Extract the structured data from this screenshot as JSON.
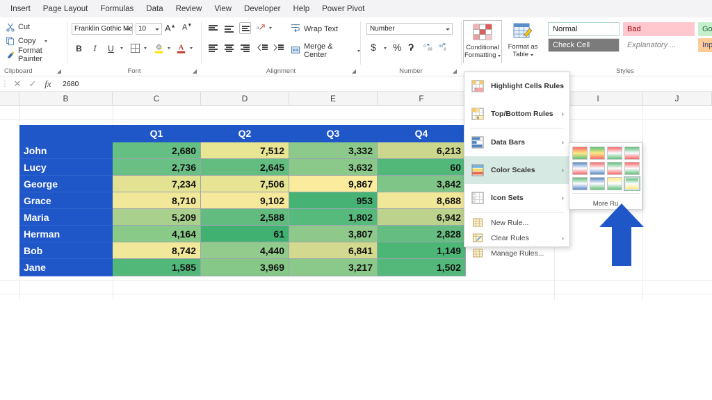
{
  "menubar": {
    "items": [
      {
        "label": "Insert"
      },
      {
        "label": "Page Layout"
      },
      {
        "label": "Formulas"
      },
      {
        "label": "Data"
      },
      {
        "label": "Review"
      },
      {
        "label": "View"
      },
      {
        "label": "Developer"
      },
      {
        "label": "Help"
      },
      {
        "label": "Power Pivot"
      }
    ]
  },
  "ribbon": {
    "clipboard": {
      "label": "Clipboard",
      "cut": "Cut",
      "copy": "Copy",
      "format_painter": "Format Painter"
    },
    "font": {
      "label": "Font",
      "font_name": "Franklin Gothic Me",
      "font_size": "10",
      "grow_font": "A",
      "shrink_font": "A",
      "bold": "B",
      "italic": "I",
      "underline": "U"
    },
    "alignment": {
      "label": "Alignment",
      "wrap_text": "Wrap Text",
      "merge_center": "Merge & Center"
    },
    "number": {
      "label": "Number",
      "format": "Number",
      "currency": "$",
      "percent": "%",
      "comma": "ʔ"
    },
    "styles": {
      "label": "Styles",
      "conditional_formatting": "Conditional\nFormatting",
      "conditional_formatting_l1": "Conditional",
      "conditional_formatting_l2": "Formatting",
      "format_as_table_l1": "Format as",
      "format_as_table_l2": "Table",
      "cells": [
        {
          "label": "Normal",
          "bg": "#ffffff",
          "fg": "#222222",
          "border": "#a9d5c3",
          "italic": false
        },
        {
          "label": "Bad",
          "bg": "#ffc7ce",
          "fg": "#9c0006",
          "border": "#ffc7ce",
          "italic": false
        },
        {
          "label": "Good",
          "bg": "#c6efce",
          "fg": "#1f6b38",
          "border": "#c6efce",
          "italic": false
        },
        {
          "label": "Check Cell",
          "bg": "#7b7b7b",
          "fg": "#ffffff",
          "border": "#7b7b7b",
          "italic": false
        },
        {
          "label": "Explanatory ...",
          "bg": "#ffffff",
          "fg": "#7f7f7f",
          "border": "#ffffff",
          "italic": true
        },
        {
          "label": "Input",
          "bg": "#ffcc99",
          "fg": "#3f3f76",
          "border": "#ffcc99",
          "italic": false
        }
      ]
    }
  },
  "formula_bar": {
    "cancel": "✕",
    "confirm": "✓",
    "fx": "fx",
    "value": "2680"
  },
  "grid": {
    "column_headers": [
      "B",
      "C",
      "D",
      "E",
      "F",
      "I",
      "J"
    ],
    "table_header": [
      "",
      "Q1",
      "Q2",
      "Q3",
      "Q4"
    ],
    "rows": [
      {
        "name": "John",
        "values": [
          "2,680",
          "7,512",
          "3,332",
          "6,213"
        ],
        "colors": [
          "#66bf82",
          "#e8e593",
          "#8cc98a",
          "#cbd78d"
        ]
      },
      {
        "name": "Lucy",
        "values": [
          "2,736",
          "2,645",
          "3,632",
          "60"
        ],
        "colors": [
          "#6abf84",
          "#63bd80",
          "#8ac98a",
          "#51b879"
        ]
      },
      {
        "name": "George",
        "values": [
          "7,234",
          "7,506",
          "9,867",
          "3,842"
        ],
        "colors": [
          "#e2e292",
          "#e7e493",
          "#fbeb9d",
          "#7fc587"
        ]
      },
      {
        "name": "Grace",
        "values": [
          "8,710",
          "9,102",
          "953",
          "8,688"
        ],
        "colors": [
          "#f2e89a",
          "#f6e99b",
          "#46b374",
          "#f1e799"
        ]
      },
      {
        "name": "Maria",
        "values": [
          "5,209",
          "2,588",
          "1,802",
          "6,942"
        ],
        "colors": [
          "#a9d08c",
          "#62bc7f",
          "#55ba7b",
          "#bdd38d"
        ]
      },
      {
        "name": "Herman",
        "values": [
          "4,164",
          "61",
          "3,807",
          "2,828"
        ],
        "colors": [
          "#8aca89",
          "#41b171",
          "#8ec98b",
          "#65bd81"
        ]
      },
      {
        "name": "Bob",
        "values": [
          "8,742",
          "4,440",
          "6,841",
          "1,149"
        ],
        "colors": [
          "#f2e89a",
          "#92cb8c",
          "#d3da8f",
          "#4cb677"
        ]
      },
      {
        "name": "Jane",
        "values": [
          "1,585",
          "3,969",
          "3,217",
          "1,502"
        ],
        "colors": [
          "#52b87a",
          "#86c888",
          "#8ac98a",
          "#53b87a"
        ]
      }
    ]
  },
  "cf_menu": {
    "items": [
      {
        "label": "Highlight Cells Rules",
        "has_submenu": true,
        "selected": false
      },
      {
        "label": "Top/Bottom Rules",
        "has_submenu": true,
        "selected": false
      },
      {
        "label": "Data Bars",
        "has_submenu": true,
        "selected": false
      },
      {
        "label": "Color Scales",
        "has_submenu": true,
        "selected": true
      },
      {
        "label": "Icon Sets",
        "has_submenu": true,
        "selected": false
      }
    ],
    "commands": [
      {
        "label": "New Rule...",
        "has_submenu": false
      },
      {
        "label": "Clear Rules",
        "has_submenu": true
      },
      {
        "label": "Manage Rules...",
        "has_submenu": false
      }
    ]
  },
  "flyout": {
    "more_rules": "More Ru",
    "more_rules_full": "More Rules...",
    "swatches": [
      {
        "selected": false,
        "colors": [
          "#f8696b",
          "#ffeb84",
          "#63be7b"
        ]
      },
      {
        "selected": false,
        "colors": [
          "#63be7b",
          "#ffeb84",
          "#f8696b"
        ]
      },
      {
        "selected": false,
        "colors": [
          "#f8696b",
          "#fcfcff",
          "#63be7b"
        ]
      },
      {
        "selected": false,
        "colors": [
          "#63be7b",
          "#fcfcff",
          "#f8696b"
        ]
      },
      {
        "selected": false,
        "colors": [
          "#5a8ac6",
          "#fcfcff",
          "#f8696b"
        ]
      },
      {
        "selected": false,
        "colors": [
          "#f8696b",
          "#fcfcff",
          "#5a8ac6"
        ]
      },
      {
        "selected": false,
        "colors": [
          "#63be7b",
          "#fcfcff",
          "#f8696b"
        ]
      },
      {
        "selected": false,
        "colors": [
          "#f8696b",
          "#fcfcff",
          "#63be7b"
        ]
      },
      {
        "selected": false,
        "colors": [
          "#63be7b",
          "#fcfcff",
          "#5a8ac6"
        ]
      },
      {
        "selected": false,
        "colors": [
          "#5a8ac6",
          "#fcfcff",
          "#63be7b"
        ]
      },
      {
        "selected": false,
        "colors": [
          "#ffeb84",
          "#fcfcff",
          "#63be7b"
        ]
      },
      {
        "selected": true,
        "colors": [
          "#63be7b",
          "#fcfcff",
          "#ffeb84"
        ]
      }
    ]
  },
  "annotation": {
    "arrow_color": "#1f56c8",
    "arrow_direction": "up"
  },
  "colors": {
    "excel_blue": "#1f56c8",
    "ribbon_bg": "#ffffff",
    "menubar_bg": "#f3f3f6",
    "selection_green": "#d7e9e3"
  }
}
